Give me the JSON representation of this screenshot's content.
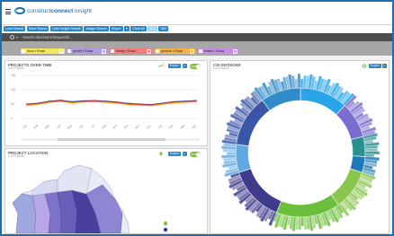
{
  "app": {
    "logo_text_light": "construct",
    "logo_text_bold": "connect",
    "logo_suffix": "insight"
  },
  "toolbar": {
    "buttons": [
      "Load Search",
      "Save Search",
      "Load Insight Search",
      "Assign Search",
      "Export",
      "Clear All",
      "ALL",
      "TAB"
    ]
  },
  "search": {
    "placeholder": "Search document keywords..."
  },
  "filters": [
    {
      "label": "truck • Rows",
      "color": "#f5e65b"
    },
    {
      "label": "permit • Rows",
      "color": "#b29ae0"
    },
    {
      "label": "library • Rows",
      "color": "#f47c7c"
    },
    {
      "label": "general • Rows",
      "color": "#f6b244"
    },
    {
      "label": "bidder • Rows",
      "color": "#c88ee6"
    }
  ],
  "projects_over_time": {
    "title": "PROJECTS OVER TIME",
    "subtitle": "# of Projects",
    "export_label": "Export",
    "toggle_label": "CUM",
    "y_ticks": [
      "150",
      "100",
      "50",
      "0"
    ],
    "colors": [
      "#2b3a8f",
      "#e3302f",
      "#f5a623"
    ]
  },
  "csi_divisions": {
    "title": "CSI DIVISIONS",
    "subtitle": "# of Projects",
    "export_label": "Export"
  },
  "project_location": {
    "title": "PROJECT LOCATION",
    "subtitle": "# of Projects",
    "export_label": "Export",
    "toggle_label": "CUM"
  },
  "chart_data": [
    {
      "type": "line",
      "title": "PROJECTS OVER TIME",
      "ylabel": "# of Projects",
      "ylim": [
        0,
        150
      ],
      "x": [
        "Jan",
        "Feb",
        "Mar",
        "Apr",
        "May",
        "Jun",
        "Jul",
        "Aug",
        "Sep",
        "Oct",
        "Nov",
        "Dec",
        "Jan",
        "Feb",
        "Mar",
        "Apr"
      ],
      "series": [
        {
          "values": [
            50,
            53,
            60,
            63,
            58,
            61,
            62,
            60,
            57,
            52,
            50,
            48,
            53,
            58,
            60,
            62
          ]
        },
        {
          "values": [
            48,
            51,
            58,
            61,
            56,
            59,
            60,
            58,
            55,
            50,
            48,
            46,
            51,
            56,
            58,
            60
          ]
        },
        {
          "values": [
            46,
            49,
            56,
            59,
            54,
            57,
            58,
            56,
            53,
            48,
            46,
            44,
            49,
            54,
            56,
            58
          ]
        }
      ]
    },
    {
      "type": "pie",
      "title": "CSI DIVISIONS",
      "ylabel": "# of Projects",
      "values": [
        12,
        9,
        5,
        4,
        10,
        16,
        14,
        7,
        13,
        10
      ]
    }
  ]
}
